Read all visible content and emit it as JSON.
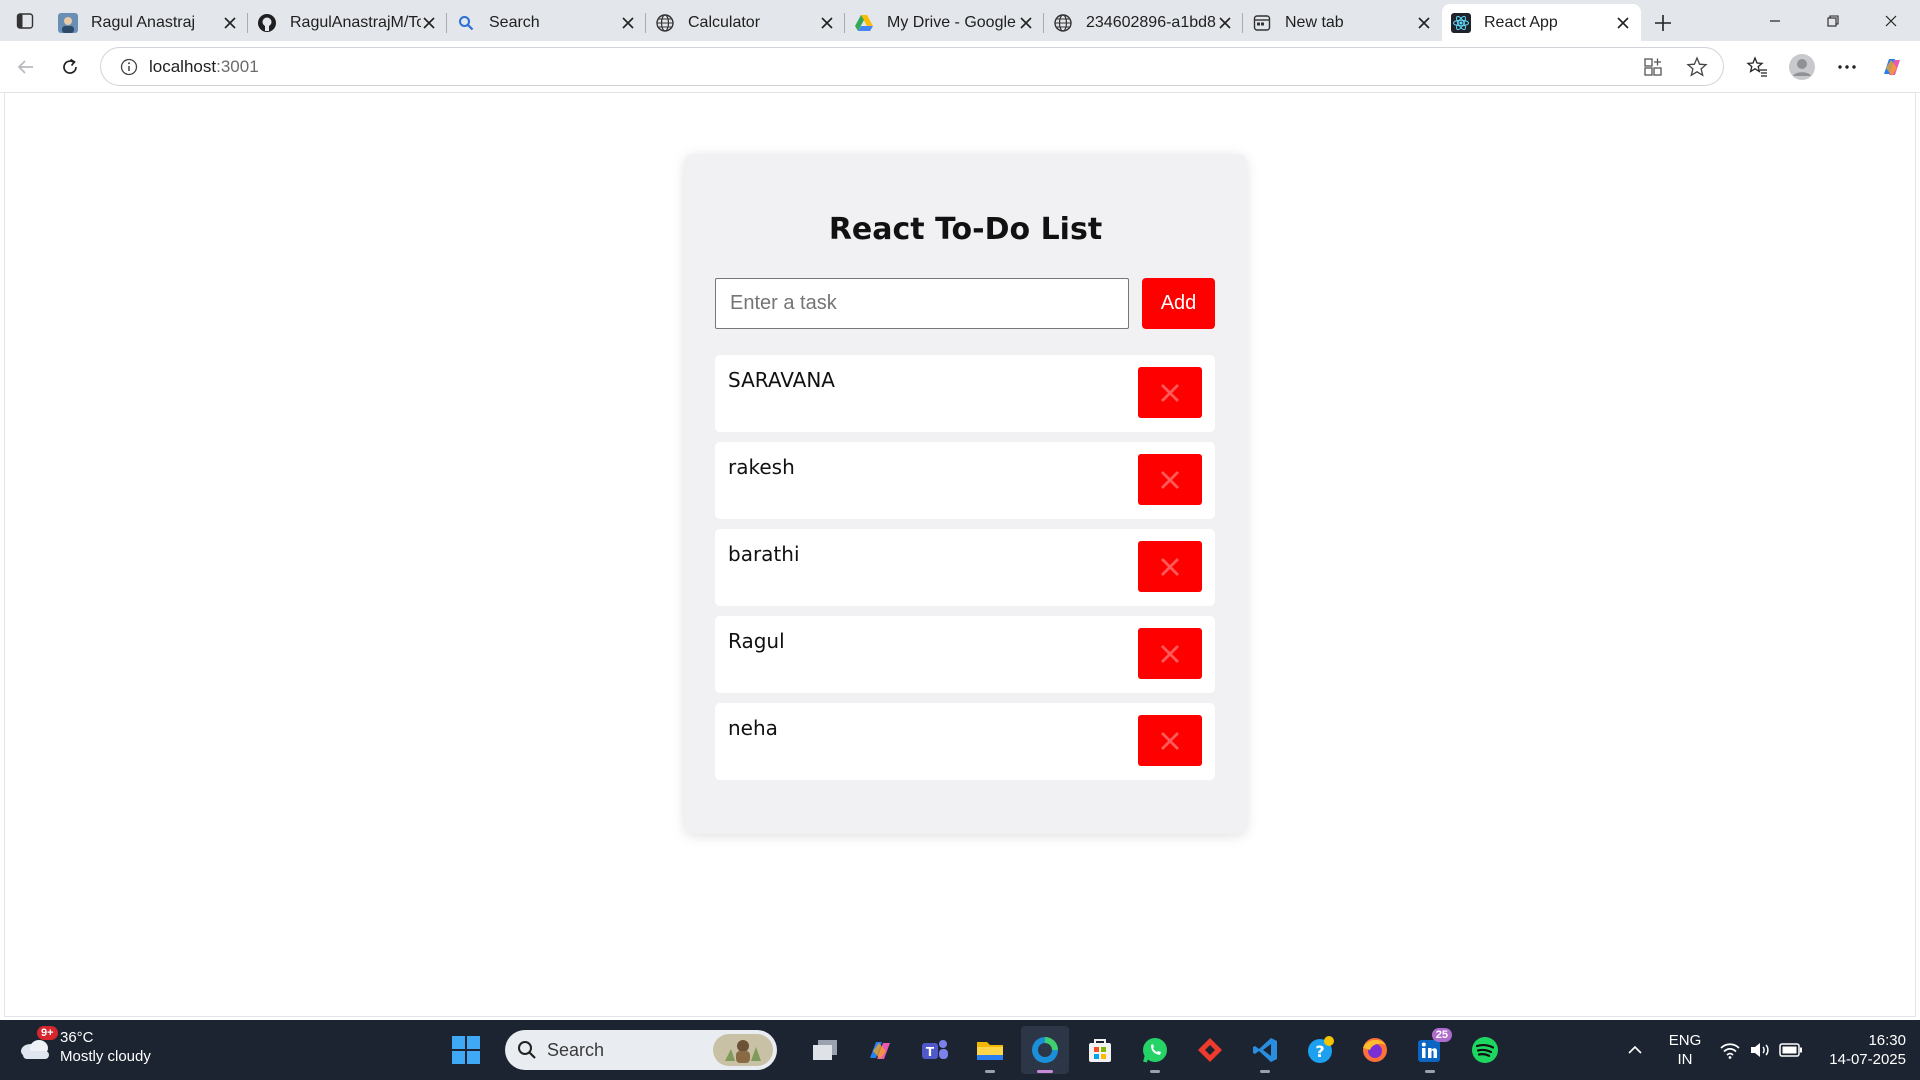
{
  "browser": {
    "tabs": [
      {
        "title": "Ragul Anastraj",
        "icon": "profile-photo-icon"
      },
      {
        "title": "RagulAnastrajM/To",
        "icon": "github-icon"
      },
      {
        "title": "Search",
        "icon": "search-icon"
      },
      {
        "title": "Calculator",
        "icon": "globe-icon"
      },
      {
        "title": "My Drive - Google",
        "icon": "google-drive-icon"
      },
      {
        "title": "234602896-a1bd8",
        "icon": "globe-icon"
      },
      {
        "title": "New tab",
        "icon": "new-tab-page-icon"
      },
      {
        "title": "React App",
        "icon": "react-icon",
        "active": true
      }
    ],
    "address": {
      "host": "localhost",
      "port": ":3001"
    }
  },
  "app": {
    "title": "React To-Do List",
    "input_placeholder": "Enter a task",
    "add_label": "Add",
    "tasks": [
      "SARAVANA",
      "rakesh",
      "barathi",
      "Ragul",
      "neha"
    ],
    "accent_color": "#ff0000"
  },
  "taskbar": {
    "weather": {
      "badge": "9+",
      "temp": "36°C",
      "condition": "Mostly cloudy"
    },
    "search_label": "Search",
    "linkedin_badge": "25",
    "lang": {
      "line1": "ENG",
      "line2": "IN"
    },
    "clock": {
      "time": "16:30",
      "date": "14-07-2025"
    }
  }
}
